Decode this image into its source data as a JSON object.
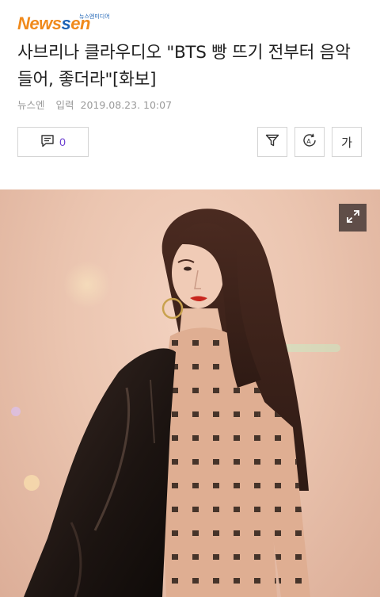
{
  "header": {
    "logo_part1": "News",
    "logo_part2": "en",
    "logo_s": "s",
    "logo_sub": "뉴스엔미디어"
  },
  "article": {
    "title": "사브리나 클라우디오 \"BTS 빵 뜨기 전부터 음악 들어, 좋더라\"[화보]",
    "source": "뉴스엔",
    "date_label": "입력",
    "date": "2019.08.23. 10:07"
  },
  "toolbar": {
    "comment_count": "0",
    "font_button_label": "가"
  },
  "colors": {
    "logo_orange": "#f08a1c",
    "logo_blue": "#1e63b5",
    "comment_count": "#6b3fd0"
  },
  "icons": [
    "comment-icon",
    "filter-icon",
    "translate-icon",
    "expand-icon"
  ]
}
